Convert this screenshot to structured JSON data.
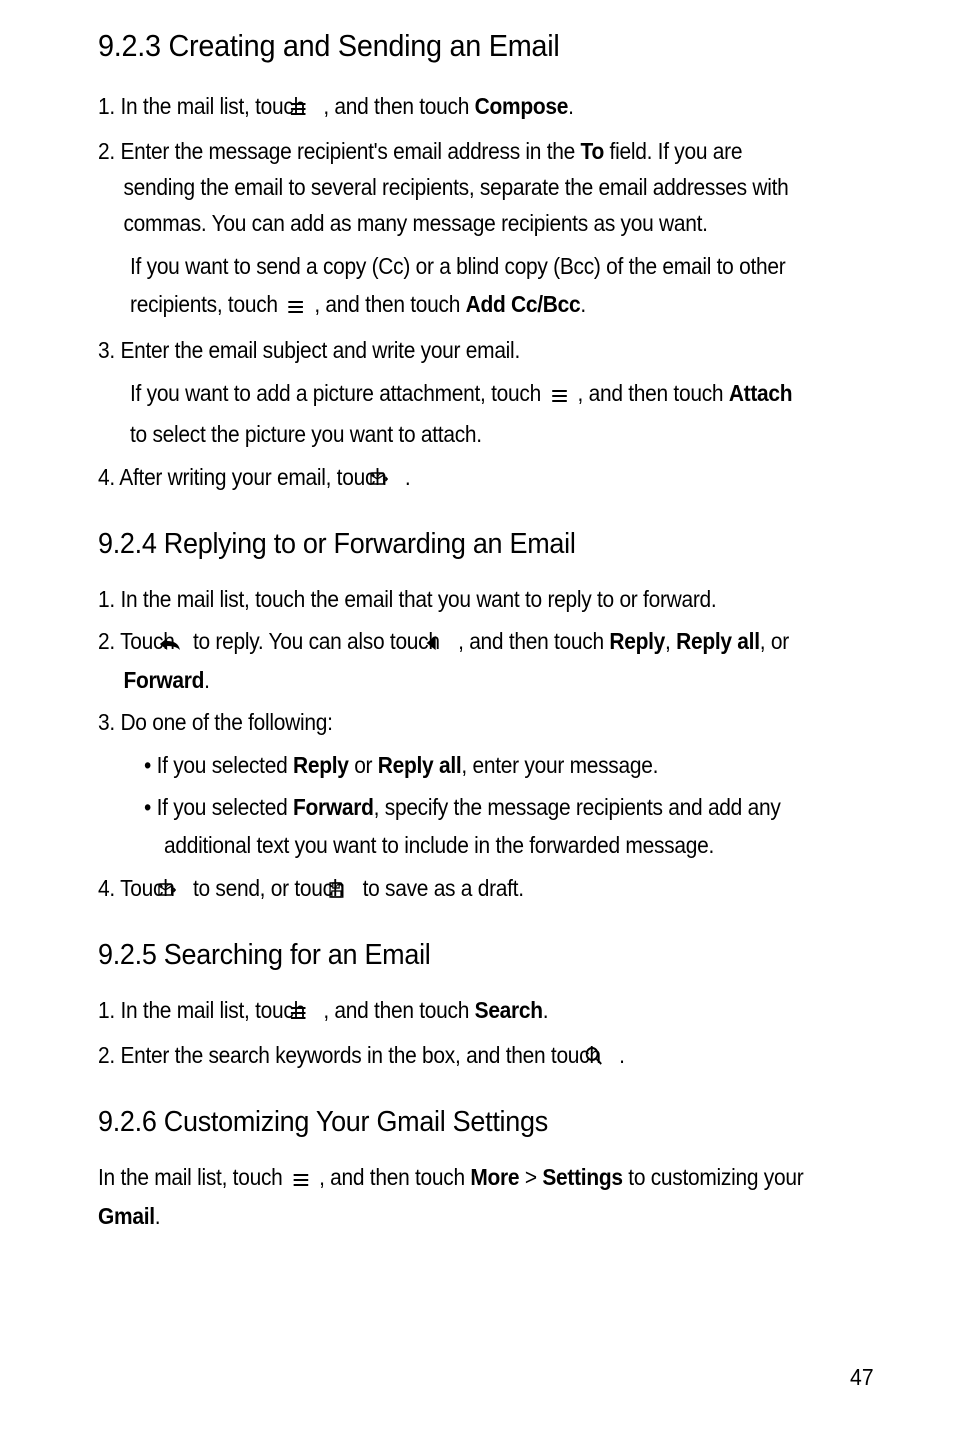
{
  "s923": {
    "heading": "9.2.3  Creating and Sending an Email",
    "step1_a": "1. In the mail list, touch ",
    "step1_b": " , and then touch ",
    "step1_c": "Compose",
    "step1_d": ".",
    "step2_a": "2. Enter the message recipient's email address in the ",
    "step2_b": "To",
    "step2_c": " field. If you are sending the email to several recipients, separate the email addresses with commas. You can add as many message recipients as you want.",
    "note1_a": "If you want to send a copy (Cc) or a blind copy (Bcc) of the email to other recipients, touch ",
    "note1_b": " , and then touch ",
    "note1_c": "Add Cc/Bcc",
    "note1_d": ".",
    "step3": "3. Enter the email subject and write your email.",
    "note2_a": "If you want to add a picture attachment, touch ",
    "note2_b": " , and then touch ",
    "note2_c": "Attach",
    "note2_d": " to select the picture you want to attach.",
    "step4_a": "4. After writing your email, touch ",
    "step4_b": " ."
  },
  "s924": {
    "heading": "9.2.4  Replying to or Forwarding an Email",
    "step1": "1. In the mail list, touch the email that you want to reply to or forward.",
    "step2_a": "2. Touch ",
    "step2_b": " to reply. You can also touch ",
    "step2_c": " , and then touch ",
    "step2_d": "Reply",
    "step2_e": ", ",
    "step2_f": "Reply all",
    "step2_g": ", or ",
    "step2_h": "Forward",
    "step2_i": ".",
    "step3": "3. Do one of the following:",
    "bullet1_a": "•  If you selected ",
    "bullet1_b": "Reply",
    "bullet1_c": " or ",
    "bullet1_d": "Reply all",
    "bullet1_e": ", enter your message.",
    "bullet2_a": "•  If you selected ",
    "bullet2_b": "Forward",
    "bullet2_c": ", specify the message recipients and add any additional text you want to include in the forwarded message.",
    "step4_a": "4. Touch ",
    "step4_b": " to send, or touch ",
    "step4_c": " to save as a draft."
  },
  "s925": {
    "heading": "9.2.5  Searching for an Email",
    "step1_a": "1. In the mail list, touch ",
    "step1_b": " , and then touch ",
    "step1_c": "Search",
    "step1_d": ".",
    "step2_a": "2. Enter the search keywords in the box, and then touch ",
    "step2_b": " ."
  },
  "s926": {
    "heading": "9.2.6  Customizing Your Gmail Settings",
    "intro_a": "In the mail list, touch ",
    "intro_b": " , and then touch ",
    "intro_c": "More",
    "intro_d": " > ",
    "intro_e": "Settings",
    "intro_f": " to customizing your ",
    "intro_g": "Gmail",
    "intro_h": "."
  },
  "page_number": "47"
}
